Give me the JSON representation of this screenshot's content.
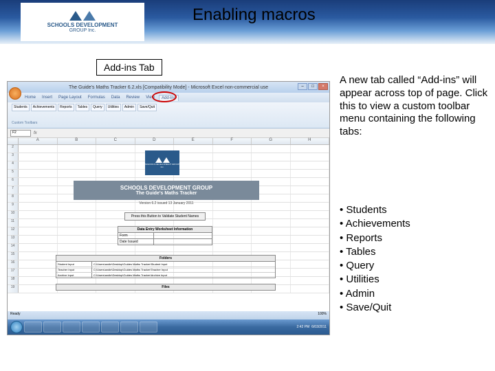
{
  "header": {
    "logo_line1": "SCHOOLS DEVELOPMENT",
    "logo_line2": "GROUP Inc.",
    "title": "Enabling macros"
  },
  "callout": "Add-ins Tab",
  "description": "A new tab called “Add-ins” will appear across top of page. Click this to view a custom toolbar menu containing the following tabs:",
  "bullets": [
    "Students",
    "Achievements",
    "Reports",
    "Tables",
    "Query",
    "Utilities",
    "Admin",
    "Save/Quit"
  ],
  "screenshot": {
    "window_title": "The Guide's Maths Tracker 6.2.xls [Compatibility Mode] - Microsoft Excel non-commercial use",
    "ribbon_tabs": [
      "Home",
      "Insert",
      "Page Layout",
      "Formulas",
      "Data",
      "Review",
      "View",
      "Add-Ins"
    ],
    "active_tab_index": 7,
    "custom_toolbar": [
      "Students",
      "Achievements",
      "Reports",
      "Tables",
      "Query",
      "Utilities",
      "Admin",
      "Save/Quit"
    ],
    "ribbon_group_label": "Custom Toolbars",
    "namebox": "F2",
    "columns": [
      "A",
      "B",
      "C",
      "D",
      "E",
      "F",
      "G",
      "H"
    ],
    "rows": [
      "2",
      "3",
      "4",
      "5",
      "6",
      "7",
      "8",
      "9",
      "10",
      "11",
      "12",
      "13",
      "14",
      "15",
      "16",
      "17",
      "18",
      "19"
    ],
    "sheet_logo": "SCHOOLS DEVELOPMENT GROUP Inc.",
    "banner_line1": "SCHOOLS DEVELOPMENT GROUP",
    "banner_line2": "The Guide's Maths Tracker",
    "version_line": "Version 6.2 issued 13 January 2011",
    "button1": "Press this Button to Validate Student Names",
    "dw_header": "Data Entry Worksheet Information",
    "dw_rows": [
      [
        "Form",
        ""
      ],
      [
        "Date Issued",
        ""
      ]
    ],
    "folders_header": "Folders",
    "folders_rows": [
      [
        "Student Input",
        "C:\\Users\\andie\\Desktop\\Guides Maths Tracker\\Student Input"
      ],
      [
        "Teacher Input",
        "C:\\Users\\andie\\Desktop\\Guides Maths Tracker\\Teacher Input"
      ],
      [
        "Archive Input",
        "C:\\Users\\andie\\Desktop\\Guides Maths Tracker\\Archive Input"
      ]
    ],
    "files_header": "Files",
    "status_left": "Ready",
    "status_right": "100%",
    "tray_time": "2:42 PM",
    "tray_date": "6/03/2011"
  }
}
